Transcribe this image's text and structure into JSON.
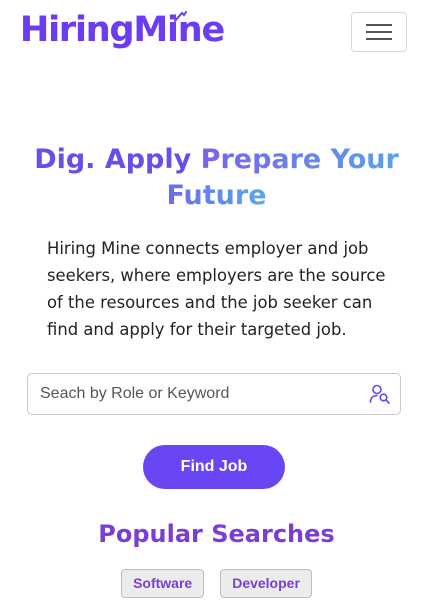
{
  "header": {
    "logo_part1": "Hiring",
    "logo_part2": "Mine",
    "menu_icon": "hamburger-icon"
  },
  "hero": {
    "title_part1": "Dig. Apply",
    "title_part2": "Prepare Your",
    "title_part3": "Future",
    "description": "Hiring Mine connects employer and job seekers, where employers are the source of the resources and the job seeker can find and apply for their targeted job."
  },
  "search": {
    "placeholder": "Seach by Role or Keyword",
    "value": "",
    "icon": "user-search-icon",
    "button_label": "Find Job"
  },
  "popular": {
    "title": "Popular Searches",
    "tags": [
      "Software",
      "Developer"
    ]
  },
  "colors": {
    "brand": "#6a45f3",
    "accent_purple": "#7a3fd2",
    "gradient_blue": "#57aaea"
  }
}
